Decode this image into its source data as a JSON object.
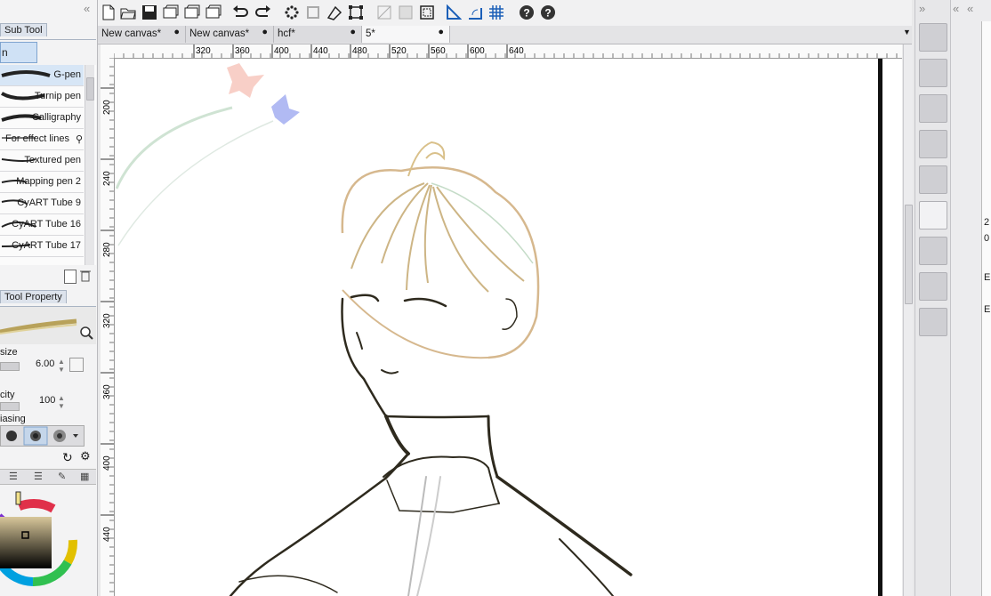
{
  "left_panel": {
    "sub_tool_tab": "Sub Tool",
    "sub_tool_group_label": "n",
    "brushes": [
      {
        "label": "G-pen",
        "selected": true
      },
      {
        "label": "Turnip pen"
      },
      {
        "label": "Calligraphy"
      },
      {
        "label": "For effect lines"
      },
      {
        "label": "Textured pen"
      },
      {
        "label": "Mapping pen 2"
      },
      {
        "label": "CyART Tube 9"
      },
      {
        "label": "CyART Tube 16"
      },
      {
        "label": "CyART Tube 17"
      }
    ],
    "tool_property_tab": "Tool Property",
    "brush_size_label": "size",
    "brush_size_value": "6.00",
    "opacity_label": "city",
    "opacity_value": "100",
    "antialiasing_label": "iasing"
  },
  "document_tabs": [
    {
      "label": "New canvas*",
      "dot": "●"
    },
    {
      "label": "New canvas*",
      "dot": "●"
    },
    {
      "label": "hcf*",
      "dot": "●"
    },
    {
      "label": "5*",
      "dot": "●",
      "active": true
    }
  ],
  "ruler_top": [
    "320",
    "360",
    "400",
    "440",
    "480",
    "520",
    "560",
    "600",
    "640"
  ],
  "ruler_left": [
    "200",
    "240",
    "280",
    "320",
    "360",
    "400",
    "440"
  ],
  "right_panel": {
    "partial_labels": [
      "2",
      "0",
      "E",
      "E"
    ]
  },
  "colors": {
    "accent": "#3a7bd5",
    "sketch_outline": "#d9b68a",
    "line_art": "#2e2a1e"
  },
  "icons": [
    "chevrons-left-icon",
    "new-file-icon",
    "open-icon",
    "save-icon",
    "undo-icon",
    "redo-icon",
    "transform-icon",
    "help-icon"
  ]
}
